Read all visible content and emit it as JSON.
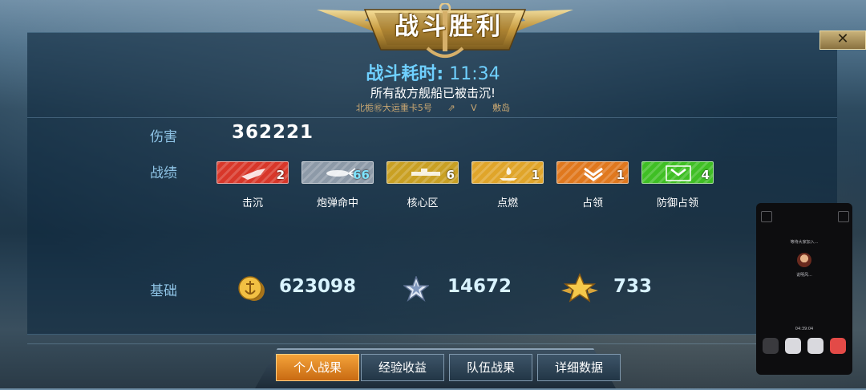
{
  "header": {
    "title": "战斗胜利",
    "close_symbol": "✕",
    "battle_time_label": "战斗耗时:",
    "battle_time_value": "11:34",
    "result_text": "所有敌方舰船已被击沉!",
    "team_left": "北栀㊗大运重卡5号",
    "vs_mark": "V",
    "team_right": "敷岛"
  },
  "damage": {
    "label": "伤害",
    "value": "362221"
  },
  "record": {
    "label": "战绩",
    "items": [
      {
        "name": "击沉",
        "count": "2",
        "icon": "sinking-ship-icon",
        "color": "#d8372a"
      },
      {
        "name": "炮弹命中",
        "count": "66",
        "icon": "shell-hit-icon",
        "color": "#8d9aa8"
      },
      {
        "name": "核心区",
        "count": "6",
        "icon": "citadel-icon",
        "color": "#c9a023"
      },
      {
        "name": "点燃",
        "count": "1",
        "icon": "fire-icon",
        "color": "#e0a52a"
      },
      {
        "name": "占领",
        "count": "1",
        "icon": "capture-chevron-icon",
        "color": "#e0781e"
      },
      {
        "name": "防御占领",
        "count": "4",
        "icon": "defend-chevron-icon",
        "color": "#3fbf24"
      }
    ]
  },
  "base": {
    "label": "基础",
    "coins": {
      "value": "623098",
      "icon": "gold-coin-icon"
    },
    "exp": {
      "value": "14672",
      "icon": "silver-star-icon"
    },
    "rank": {
      "value": "733",
      "icon": "gold-star-wings-icon"
    }
  },
  "tabs": [
    {
      "label": "个人战果",
      "active": true
    },
    {
      "label": "经验收益",
      "active": false
    },
    {
      "label": "队伍战果",
      "active": false
    },
    {
      "label": "详细数据",
      "active": false
    }
  ],
  "call_overlay": {
    "status": "等待大家加入...",
    "caller": "说明风...",
    "timer": "04:39:04"
  }
}
